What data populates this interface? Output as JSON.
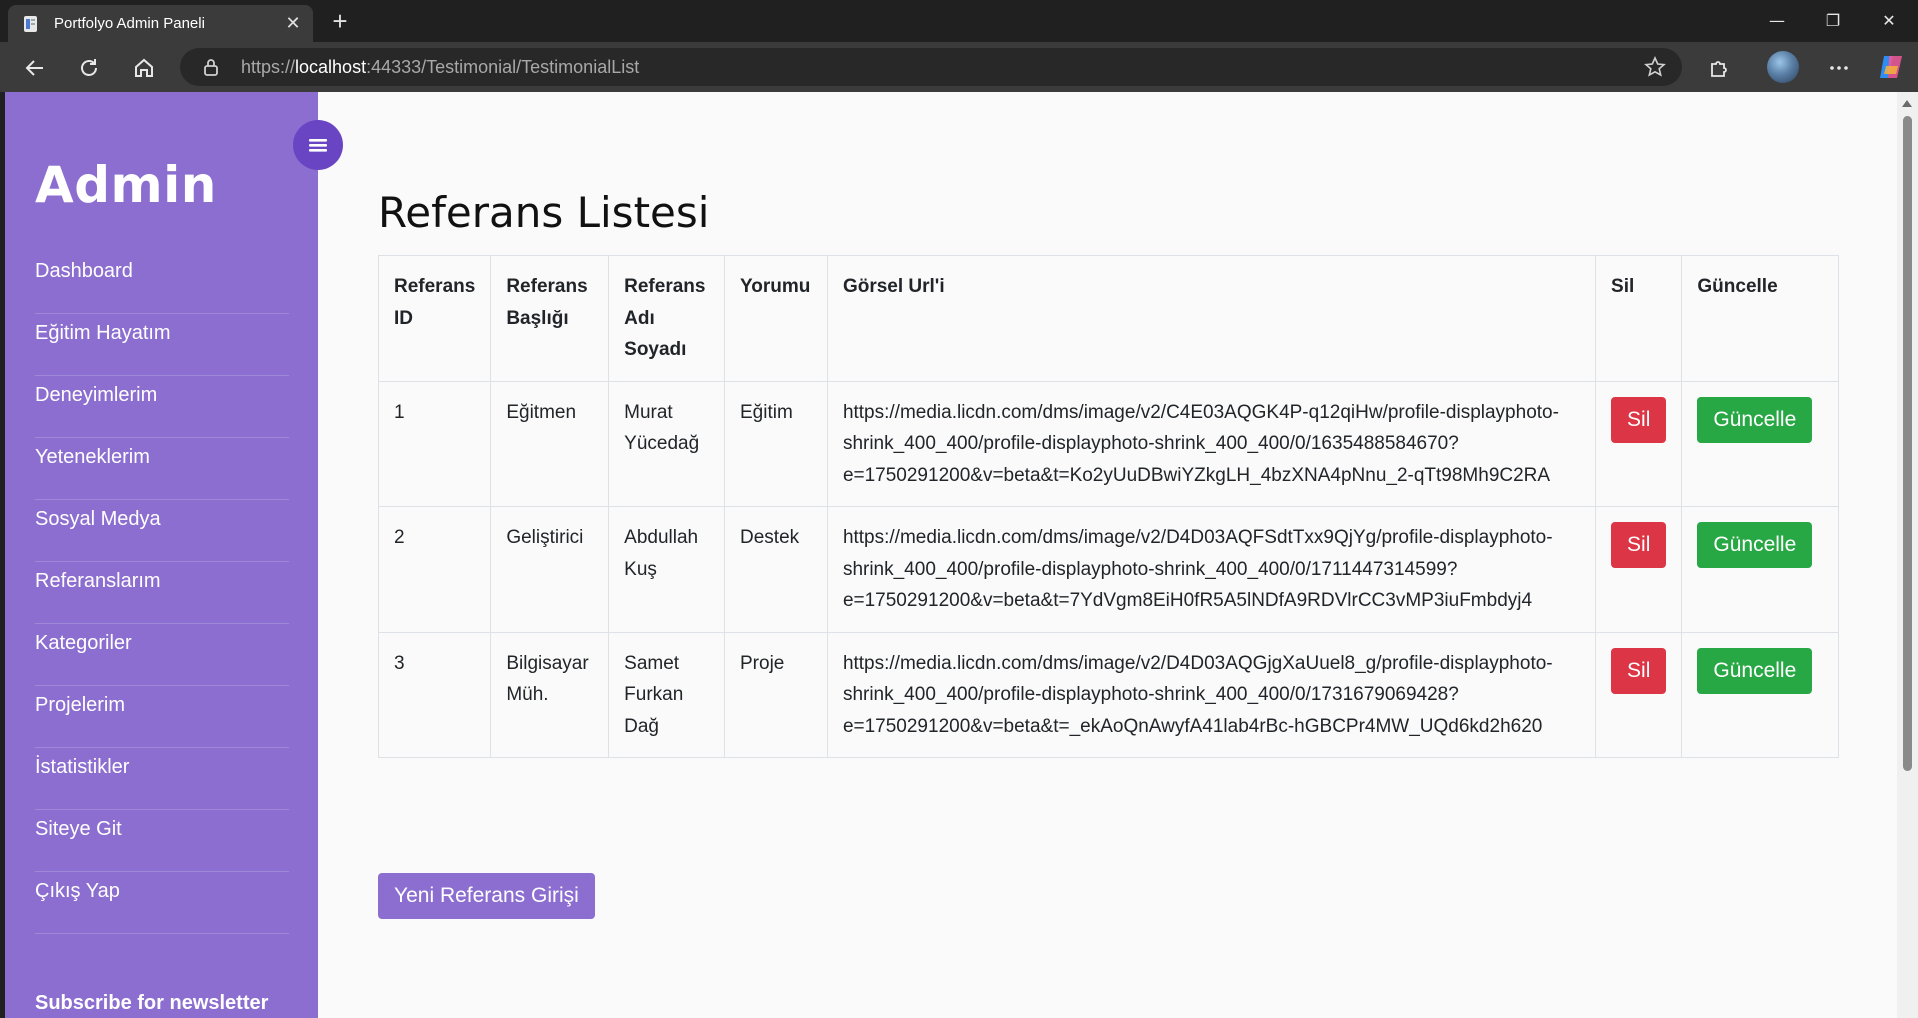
{
  "browser": {
    "tab_title": "Portfolyo Admin Paneli",
    "url_scheme": "https://",
    "url_host": "localhost",
    "url_rest": ":44333/Testimonial/TestimonialList"
  },
  "sidebar": {
    "brand": "Admin",
    "items": [
      {
        "label": "Dashboard"
      },
      {
        "label": "Eğitim Hayatım"
      },
      {
        "label": "Deneyimlerim"
      },
      {
        "label": "Yeteneklerim"
      },
      {
        "label": "Sosyal Medya"
      },
      {
        "label": "Referanslarım"
      },
      {
        "label": "Kategoriler"
      },
      {
        "label": "Projelerim"
      },
      {
        "label": "İstatistikler"
      },
      {
        "label": "Siteye Git"
      },
      {
        "label": "Çıkış Yap"
      }
    ],
    "newsletter": "Subscribe for newsletter"
  },
  "main": {
    "title": "Referans Listesi",
    "columns": [
      "Referans ID",
      "Referans Başlığı",
      "Referans Adı Soyadı",
      "Yorumu",
      "Görsel Url'i",
      "Sil",
      "Güncelle"
    ],
    "rows": [
      {
        "id": "1",
        "title": "Eğitmen",
        "name": "Murat Yücedağ",
        "comment": "Eğitim",
        "url": "https://media.licdn.com/dms/image/v2/C4E03AQGK4P-q12qiHw/profile-displayphoto-shrink_400_400/profile-displayphoto-shrink_400_400/0/1635488584670?e=1750291200&v=beta&t=Ko2yUuDBwiYZkgLH_4bzXNA4pNnu_2-qTt98Mh9C2RA"
      },
      {
        "id": "2",
        "title": "Geliştirici",
        "name": "Abdullah Kuş",
        "comment": "Destek",
        "url": "https://media.licdn.com/dms/image/v2/D4D03AQFSdtTxx9QjYg/profile-displayphoto-shrink_400_400/profile-displayphoto-shrink_400_400/0/1711447314599?e=1750291200&v=beta&t=7YdVgm8EiH0fR5A5lNDfA9RDVlrCC3vMP3iuFmbdyj4"
      },
      {
        "id": "3",
        "title": "Bilgisayar Müh.",
        "name": "Samet Furkan Dağ",
        "comment": "Proje",
        "url": "https://media.licdn.com/dms/image/v2/D4D03AQGjgXaUuel8_g/profile-displayphoto-shrink_400_400/profile-displayphoto-shrink_400_400/0/1731679069428?e=1750291200&v=beta&t=_ekAoQnAwyfA41lab4rBc-hGBCPr4MW_UQd6kd2h620"
      }
    ],
    "delete_label": "Sil",
    "update_label": "Güncelle",
    "new_button": "Yeni Referans Girişi"
  },
  "colors": {
    "sidebar": "#8c6ed0",
    "toggle": "#6a45c3",
    "danger": "#dc3545",
    "success": "#28a745"
  }
}
